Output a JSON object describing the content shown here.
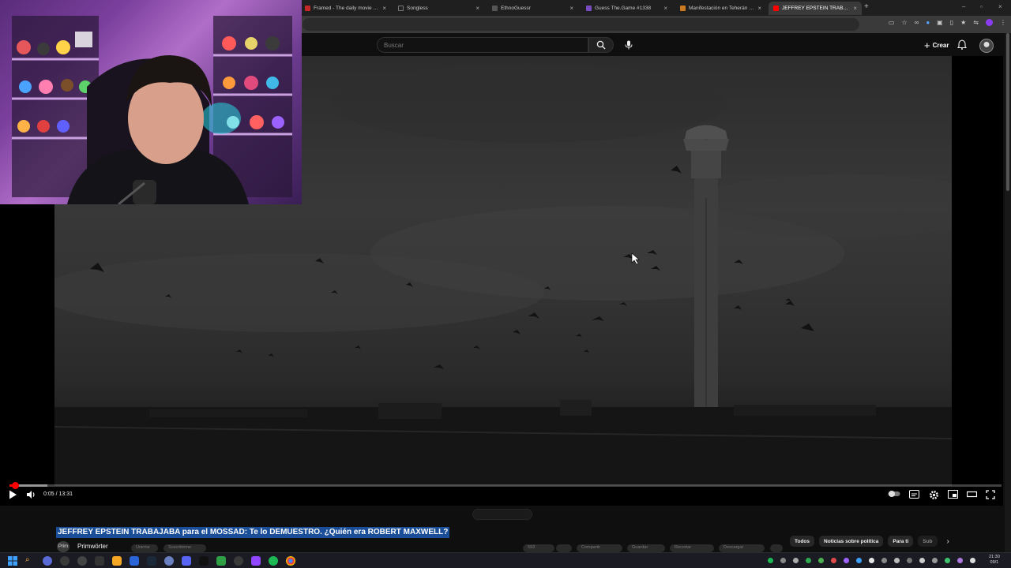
{
  "browser": {
    "tabs": [
      {
        "label": "Framed - The daily movie guessi",
        "color": "#c62828"
      },
      {
        "label": "Songless",
        "color": "#222222"
      },
      {
        "label": "EthnoGuessr",
        "color": "#555555"
      },
      {
        "label": "Guess The.Game #1338",
        "color": "#7a4cc2"
      },
      {
        "label": "Manifestación en Teherán tras",
        "color": "#cc7a22"
      },
      {
        "label": "JEFFREY EPSTEIN TRABAJABA p",
        "color": "#ff0000"
      }
    ],
    "new_tab": "+"
  },
  "youtube": {
    "search_placeholder": "Buscar",
    "create_label": "Crear"
  },
  "video": {
    "current_time": "0:05",
    "duration": "13:31",
    "time_display": "0:05 / 13:31",
    "progress_fraction": 0.0062,
    "buffered_fraction": 0.038
  },
  "below": {
    "title": "JEFFREY EPSTEIN TRABAJABA para el MOSSAD: Te lo DEMUESTRO. ¿Quién era ROBERT MAXWELL?",
    "channel_initials": "Prim",
    "channel_name": "Primwörter",
    "pill_1": "Unirme",
    "pill_2": "Suscribirme",
    "likes": "593",
    "share": "Compartir",
    "save": "Guardar",
    "clip": "Recortar",
    "download": "Descargar",
    "chips": [
      "Todos",
      "Noticias sobre política",
      "Para ti",
      "Sub"
    ]
  },
  "taskbar": {
    "time": "21:30",
    "date": "09/1"
  },
  "colors": {
    "accent_red": "#ff0000",
    "title_highlight": "#1b4e99"
  }
}
